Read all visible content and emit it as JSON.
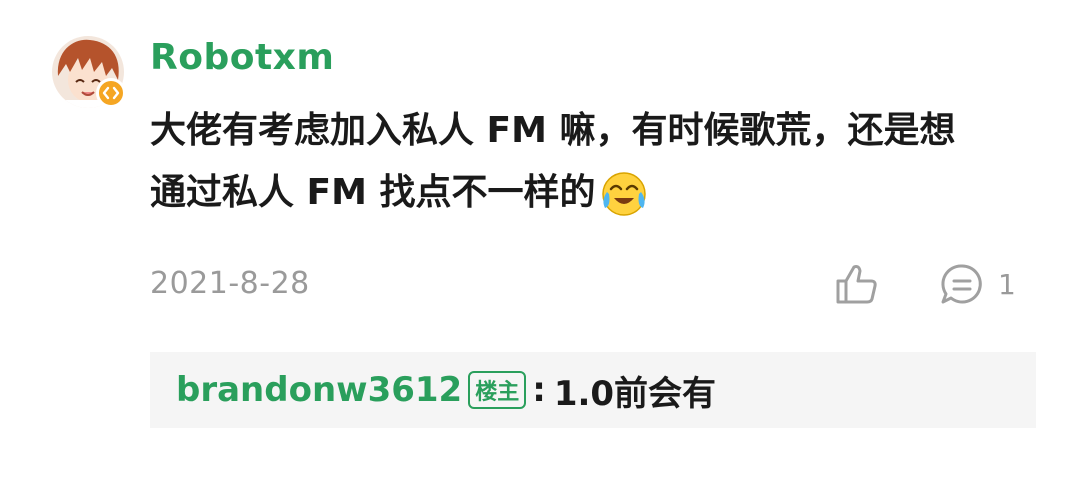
{
  "comment": {
    "username": "Robotxm",
    "body_lines": [
      "大佬有考虑加入私人 FM 嘛，有时候歌荒，还是想",
      "通过私人 FM 找点不一样的"
    ],
    "emoji": "laughing-crying-emoji",
    "date": "2021-8-28",
    "like_icon": "thumbs-up-icon",
    "reply_icon": "comment-icon",
    "reply_count": "1"
  },
  "reply": {
    "username": "brandonw3612",
    "badge": "楼主",
    "separator": ":",
    "text": "1.0前会有"
  },
  "colors": {
    "accent": "#2a9f5c",
    "muted": "#9a9a9a",
    "text": "#1a1a1a",
    "reply_bg": "#f5f5f5",
    "badge_orange": "#f5a623"
  }
}
